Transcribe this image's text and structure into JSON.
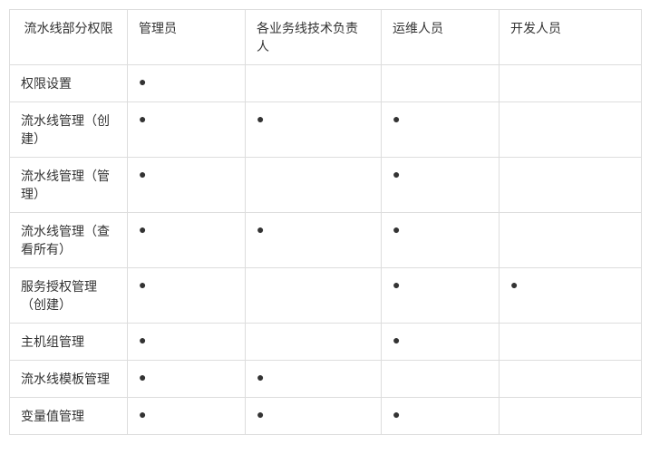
{
  "chart_data": {
    "type": "table",
    "title": "",
    "columns": [
      "流水线部分权限",
      "管理员",
      "各业务线技术负责人",
      "运维人员",
      "开发人员"
    ],
    "rows": [
      {
        "label": "权限设置",
        "管理员": true,
        "各业务线技术负责人": false,
        "运维人员": false,
        "开发人员": false
      },
      {
        "label": "流水线管理（创建）",
        "管理员": true,
        "各业务线技术负责人": true,
        "运维人员": true,
        "开发人员": false
      },
      {
        "label": "流水线管理（管理）",
        "管理员": true,
        "各业务线技术负责人": false,
        "运维人员": true,
        "开发人员": false
      },
      {
        "label": "流水线管理（查看所有）",
        "管理员": true,
        "各业务线技术负责人": true,
        "运维人员": true,
        "开发人员": false
      },
      {
        "label": "服务授权管理（创建）",
        "管理员": true,
        "各业务线技术负责人": false,
        "运维人员": true,
        "开发人员": true
      },
      {
        "label": "主机组管理",
        "管理员": true,
        "各业务线技术负责人": false,
        "运维人员": true,
        "开发人员": false
      },
      {
        "label": "流水线模板管理",
        "管理员": true,
        "各业务线技术负责人": true,
        "运维人员": false,
        "开发人员": false
      },
      {
        "label": "变量值管理",
        "管理员": true,
        "各业务线技术负责人": true,
        "运维人员": true,
        "开发人员": false
      }
    ]
  },
  "dot": "●",
  "headers": {
    "col0": "流水线部分权限",
    "col1": "管理员",
    "col2": "各业务线技术负责人",
    "col3": "运维人员",
    "col4": "开发人员"
  },
  "rows": [
    {
      "label": "权限设置",
      "c1": "●",
      "c2": "",
      "c3": "",
      "c4": ""
    },
    {
      "label": "流水线管理（创建）",
      "c1": "●",
      "c2": "●",
      "c3": "●",
      "c4": ""
    },
    {
      "label": "流水线管理（管理）",
      "c1": "●",
      "c2": "",
      "c3": "●",
      "c4": ""
    },
    {
      "label": "流水线管理（查看所有）",
      "c1": "●",
      "c2": "●",
      "c3": "●",
      "c4": ""
    },
    {
      "label": "服务授权管理（创建）",
      "c1": "●",
      "c2": "",
      "c3": "●",
      "c4": "●"
    },
    {
      "label": "主机组管理",
      "c1": "●",
      "c2": "",
      "c3": "●",
      "c4": ""
    },
    {
      "label": "流水线模板管理",
      "c1": "●",
      "c2": "●",
      "c3": "",
      "c4": ""
    },
    {
      "label": "变量值管理",
      "c1": "●",
      "c2": "●",
      "c3": "●",
      "c4": ""
    }
  ]
}
